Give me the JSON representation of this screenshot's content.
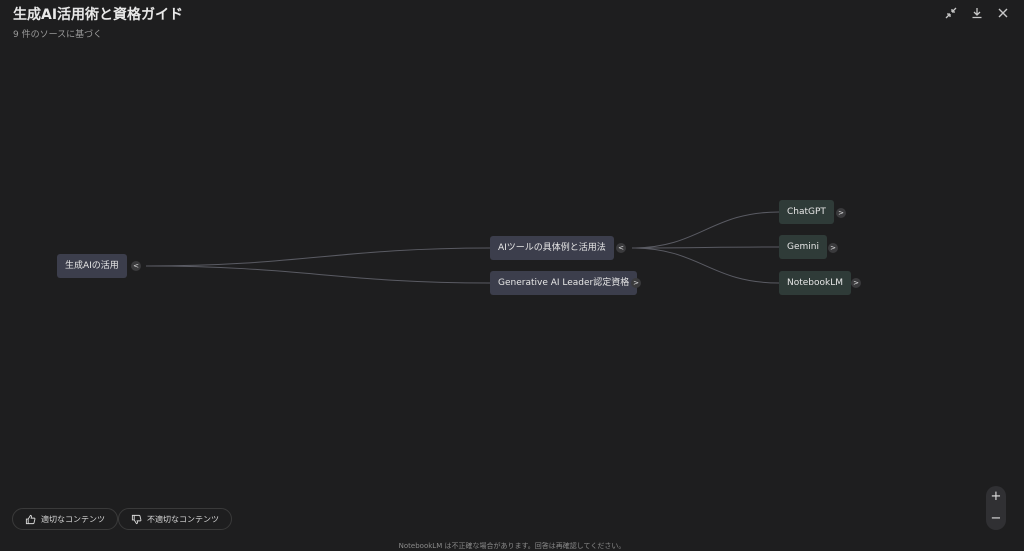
{
  "header": {
    "title": "生成AI活用術と資格ガイド",
    "subtitle": "9 件のソースに基づく",
    "icons": [
      "collapse-icon",
      "download-icon",
      "close-icon"
    ]
  },
  "mindmap": {
    "root": {
      "label": "生成AIの活用",
      "toggle": "<"
    },
    "branches": [
      {
        "label": "AIツールの具体例と活用法",
        "toggle": "<"
      },
      {
        "label": "Generative AI Leader認定資格",
        "toggle": ">"
      }
    ],
    "leaves": [
      {
        "label": "ChatGPT",
        "toggle": ">"
      },
      {
        "label": "Gemini",
        "toggle": ">"
      },
      {
        "label": "NotebookLM",
        "toggle": ">"
      }
    ]
  },
  "feedback": {
    "good_label": "適切なコンテンツ",
    "bad_label": "不適切なコンテンツ"
  },
  "zoom": {
    "in": "+",
    "out": "−"
  },
  "footer": "NotebookLM は不正確な場合があります。回答は再確認してください。"
}
